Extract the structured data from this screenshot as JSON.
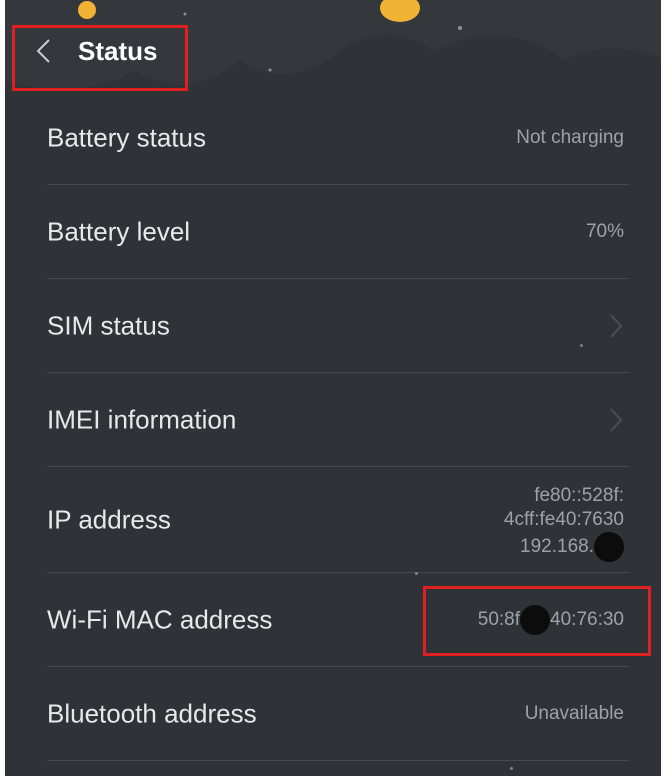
{
  "header": {
    "title": "Status",
    "back_icon": "chevron-left-icon"
  },
  "colors": {
    "background": "#2f3338",
    "annotation": "#e02020",
    "label": "#e6e8ea",
    "value": "#9da2a7"
  },
  "rows": [
    {
      "label": "Battery status",
      "value": "Not charging"
    },
    {
      "label": "Battery level",
      "value": "70%"
    },
    {
      "label": "SIM status",
      "icon": "chevron-right-icon"
    },
    {
      "label": "IMEI information",
      "icon": "chevron-right-icon"
    },
    {
      "label": "IP address",
      "value_lines": [
        "fe80::528f:",
        "4cff:fe40:7630",
        "192.168."
      ]
    },
    {
      "label": "Wi-Fi MAC address",
      "value_prefix": "50:8f",
      "value_suffix": "40:76:30"
    },
    {
      "label": "Bluetooth address",
      "value": "Unavailable"
    }
  ]
}
